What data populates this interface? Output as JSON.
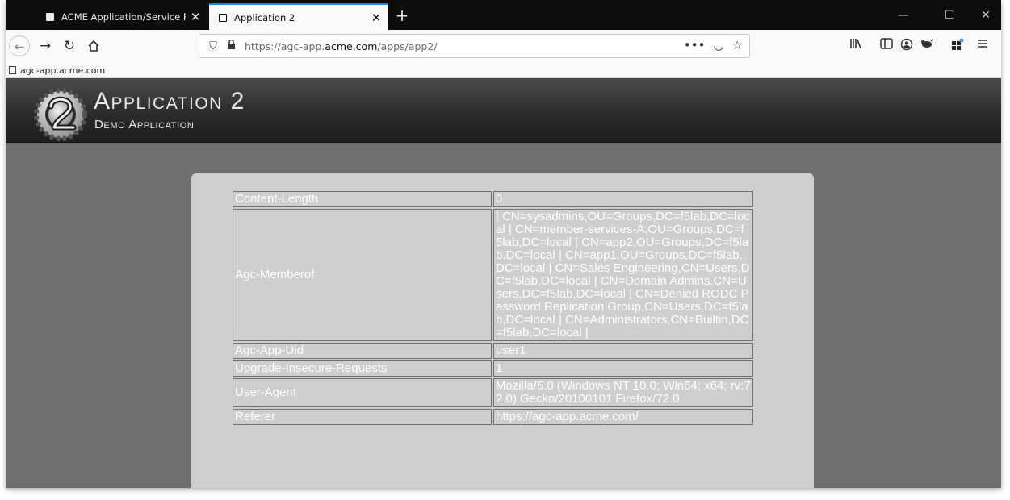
{
  "browser": {
    "tabs": [
      {
        "label": "ACME Application/Service Port",
        "active": false
      },
      {
        "label": "Application 2",
        "active": true
      }
    ],
    "close_glyph": "✕",
    "new_tab_glyph": "+",
    "window_controls": {
      "minimize": "—",
      "maximize": "☐",
      "close": "✕"
    },
    "url": {
      "prefix": "https://agc-app.",
      "domain": "acme.com",
      "path": "/apps/app2/"
    },
    "url_actions": [
      "•••",
      "◡",
      "☆"
    ],
    "bookmark": "agc-app.acme.com",
    "accent": "#0a84ff"
  },
  "app": {
    "title": "Application 2",
    "subtitle": "Demo Application"
  },
  "headers": {
    "rows": [
      {
        "name": "Content-Length",
        "value": "0"
      },
      {
        "name": "Agc-Memberof",
        "value": "| CN=sysadmins,OU=Groups,DC=f5lab,DC=local | CN=member-services-A,OU=Groups,DC=f5lab,DC=local | CN=app2,OU=Groups,DC=f5lab,DC=local | CN=app1,OU=Groups,DC=f5lab,DC=local | CN=Sales Engineering,CN=Users,DC=f5lab,DC=local | CN=Domain Admins,CN=Users,DC=f5lab,DC=local | CN=Denied RODC Password Replication Group,CN=Users,DC=f5lab,DC=local | CN=Administrators,CN=Builtin,DC=f5lab,DC=local |"
      },
      {
        "name": "Agc-App-Uid",
        "value": "user1"
      },
      {
        "name": "Upgrade-Insecure-Requests",
        "value": "1"
      },
      {
        "name": "User-Agent",
        "value": "Mozilla/5.0 (Windows NT 10.0; Win64; x64; rv:72.0) Gecko/20100101 Firefox/72.0"
      },
      {
        "name": "Referer",
        "value": "https://agc-app.acme.com/"
      }
    ]
  }
}
